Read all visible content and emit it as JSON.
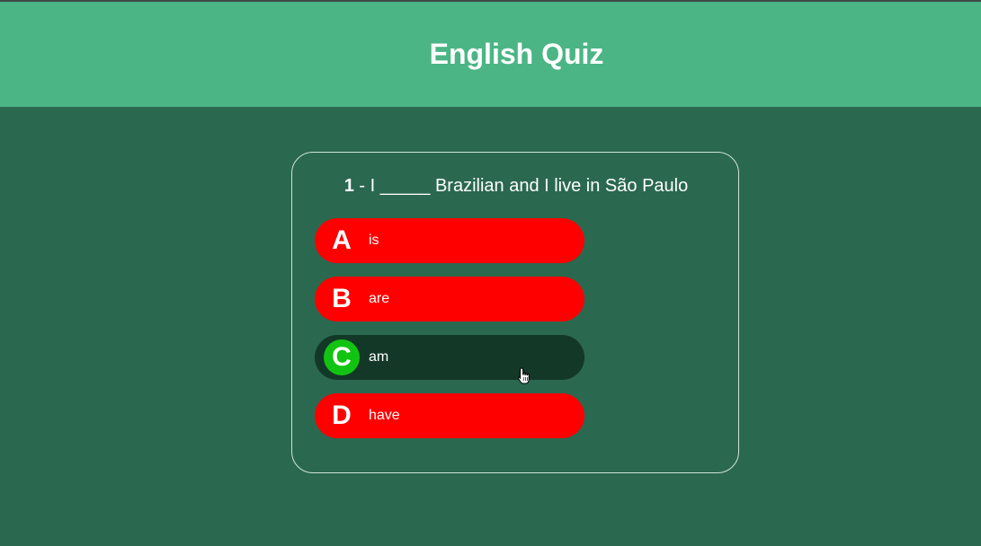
{
  "header": {
    "title": "English Quiz"
  },
  "question": {
    "number": "1",
    "separator": " - ",
    "text": "I _____ Brazilian and I live in São Paulo"
  },
  "options": [
    {
      "letter": "A",
      "text": "is",
      "selected": false
    },
    {
      "letter": "B",
      "text": "are",
      "selected": false
    },
    {
      "letter": "C",
      "text": "am",
      "selected": true
    },
    {
      "letter": "D",
      "text": "have",
      "selected": false
    }
  ],
  "colors": {
    "header_bg": "#4bb585",
    "page_bg": "#2a684f",
    "option_bg": "#ff0000",
    "selected_bg": "#133828",
    "correct_badge": "#12c412"
  },
  "cursor": {
    "icon": "hand-pointer-icon"
  }
}
